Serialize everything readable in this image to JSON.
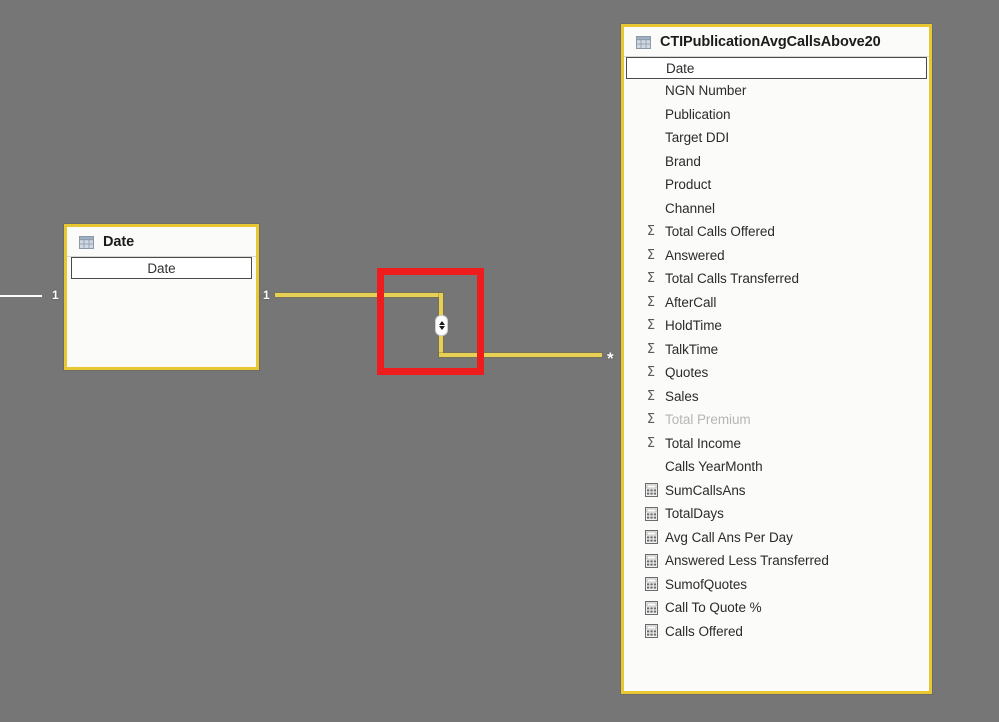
{
  "canvas": {
    "background_color": "#767676",
    "border_color": "#e8c832",
    "relationship_line_color": "#e8cf55",
    "annotation_color": "#ee1c1c"
  },
  "date_table": {
    "name": "date-table",
    "title": "Date",
    "icon": "table-icon",
    "fields": [
      {
        "label": "Date",
        "icon": "none",
        "selected": true,
        "dimmed": false
      }
    ]
  },
  "fact_table": {
    "name": "cti-publication-table",
    "title": "CTIPublicationAvgCallsAbove20",
    "icon": "table-icon",
    "fields": [
      {
        "label": "Date",
        "icon": "none",
        "selected": true,
        "dimmed": false
      },
      {
        "label": "NGN Number",
        "icon": "none",
        "selected": false,
        "dimmed": false
      },
      {
        "label": "Publication",
        "icon": "none",
        "selected": false,
        "dimmed": false
      },
      {
        "label": "Target DDI",
        "icon": "none",
        "selected": false,
        "dimmed": false
      },
      {
        "label": "Brand",
        "icon": "none",
        "selected": false,
        "dimmed": false
      },
      {
        "label": "Product",
        "icon": "none",
        "selected": false,
        "dimmed": false
      },
      {
        "label": "Channel",
        "icon": "none",
        "selected": false,
        "dimmed": false
      },
      {
        "label": "Total Calls Offered",
        "icon": "sigma-icon",
        "selected": false,
        "dimmed": false
      },
      {
        "label": "Answered",
        "icon": "sigma-icon",
        "selected": false,
        "dimmed": false
      },
      {
        "label": "Total Calls Transferred",
        "icon": "sigma-icon",
        "selected": false,
        "dimmed": false
      },
      {
        "label": "AfterCall",
        "icon": "sigma-icon",
        "selected": false,
        "dimmed": false
      },
      {
        "label": "HoldTime",
        "icon": "sigma-icon",
        "selected": false,
        "dimmed": false
      },
      {
        "label": "TalkTime",
        "icon": "sigma-icon",
        "selected": false,
        "dimmed": false
      },
      {
        "label": "Quotes",
        "icon": "sigma-icon",
        "selected": false,
        "dimmed": false
      },
      {
        "label": "Sales",
        "icon": "sigma-icon",
        "selected": false,
        "dimmed": false
      },
      {
        "label": "Total Premium",
        "icon": "sigma-icon",
        "selected": false,
        "dimmed": true
      },
      {
        "label": "Total Income",
        "icon": "sigma-icon",
        "selected": false,
        "dimmed": false
      },
      {
        "label": "Calls YearMonth",
        "icon": "none",
        "selected": false,
        "dimmed": false
      },
      {
        "label": "SumCallsAns",
        "icon": "measure-icon",
        "selected": false,
        "dimmed": false
      },
      {
        "label": "TotalDays",
        "icon": "measure-icon",
        "selected": false,
        "dimmed": false
      },
      {
        "label": "Avg Call Ans Per Day",
        "icon": "measure-icon",
        "selected": false,
        "dimmed": false
      },
      {
        "label": "Answered Less Transferred",
        "icon": "measure-icon",
        "selected": false,
        "dimmed": false
      },
      {
        "label": "SumofQuotes",
        "icon": "measure-icon",
        "selected": false,
        "dimmed": false
      },
      {
        "label": "Call To Quote %",
        "icon": "measure-icon",
        "selected": false,
        "dimmed": false
      },
      {
        "label": "Calls Offered",
        "icon": "measure-icon",
        "selected": false,
        "dimmed": false
      }
    ]
  },
  "relationships": [
    {
      "name": "offscreen-to-date",
      "left_cardinality": "1",
      "style": "white"
    },
    {
      "name": "date-to-cti-publication",
      "from_cardinality": "1",
      "to_cardinality": "*",
      "style": "active-yellow",
      "handle": "cross-filter-direction-handle"
    }
  ],
  "annotation": {
    "name": "red-highlight-box",
    "shape": "rectangle",
    "color": "#ee1c1c"
  }
}
